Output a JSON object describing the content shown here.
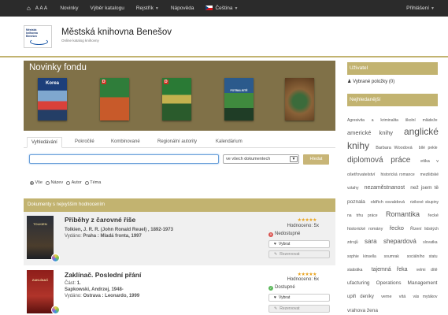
{
  "topbar": {
    "aaa": "A A A",
    "items": [
      "Novinky",
      "Výběr katalogu",
      "Rejstřík",
      "Nápověda",
      "Čeština"
    ],
    "login": "Přihlášení"
  },
  "header": {
    "logo_text": "Městská knihovna Benešov",
    "title": "Městská knihovna Benešov",
    "subtitle": "Online katalog knihovny"
  },
  "novinky": {
    "title": "Novinky fondu",
    "covers": [
      {
        "label": "Korea",
        "color": "#1d3f7a"
      },
      {
        "label": "D",
        "color": "#2f7d3a"
      },
      {
        "label": "D",
        "color": "#2a7a35"
      },
      {
        "label": "FOTBALISTÉ",
        "color": "#2b5a8c"
      },
      {
        "label": "",
        "color": "#8a6238"
      }
    ]
  },
  "search": {
    "tabs": [
      "Vyhledávání",
      "Pokročilé",
      "Kombinované",
      "Regionální autority",
      "Kalendárium"
    ],
    "input_value": "",
    "scope": "ve všech dokumentech",
    "button": "Hledat",
    "radios": [
      "Vše",
      "Název",
      "Autor",
      "Téma"
    ],
    "radio_selected": "Vše"
  },
  "best": {
    "title": "Dokumenty s nejvyšším hodnocením",
    "records": [
      {
        "title": "Příběhy z čarovné říše",
        "author": "Tolkien, J. R. R. (John Ronald Reuel) , 1892-1973",
        "published_label": "Vydáno:",
        "publisher": "Praha : Mladá fronta, 1997",
        "stars": "★★★★★",
        "rating": "Hodnoceno: 5x",
        "status": "Nedostupné",
        "status_color": "#d9534f",
        "btn_select": "Vybrat",
        "btn_reserve": "Rezervovat",
        "cover_color": "#2a2f3a"
      },
      {
        "title": "Zaklínač. Poslední přání",
        "part_label": "Část:",
        "part": "1.",
        "author": "Sapkowski, Andrzej, 1948-",
        "published_label": "Vydáno:",
        "publisher": "Ostrava : Leonardo, 1999",
        "stars": "★★★★★",
        "rating": "Hodnoceno: 6x",
        "status": "Dostupné",
        "status_color": "#5cb85c",
        "btn_select": "Vybrat",
        "btn_reserve": "Rezervovat",
        "cover_color": "#8e1e1a"
      }
    ]
  },
  "sidebar": {
    "user_title": "Uživatel",
    "selected_items": "Vybrané položky (0)",
    "popular_title": "Nejhledanější",
    "tags": [
      {
        "t": "Agresivita a kriminalita školní mládeže",
        "s": 5
      },
      {
        "t": "americké knihy",
        "s": 7.5
      },
      {
        "t": "anglické knihy",
        "s": 12
      },
      {
        "t": "Barbara Woodová",
        "s": 5.5
      },
      {
        "t": "bílé pekle",
        "s": 5
      },
      {
        "t": "diplomová práce",
        "s": 10
      },
      {
        "t": "etika v ošetřovatelství",
        "s": 5.5
      },
      {
        "t": "historická romance",
        "s": 5
      },
      {
        "t": "mezilidské vztahy",
        "s": 5
      },
      {
        "t": "nezaměstnanost",
        "s": 7
      },
      {
        "t": "než jsem tě poznala",
        "s": 6.5
      },
      {
        "t": "oldřich osvaldová",
        "s": 5.5
      },
      {
        "t": "rizikové skupiny na trhu práce",
        "s": 5
      },
      {
        "t": "Romantika",
        "s": 9
      },
      {
        "t": "řecké historické romány",
        "s": 5.5
      },
      {
        "t": "řecko",
        "s": 7.5
      },
      {
        "t": "Řízení lidských zdrojů",
        "s": 5
      },
      {
        "t": "sara",
        "s": 8
      },
      {
        "t": "shepardová",
        "s": 8
      },
      {
        "t": "slovatka",
        "s": 5
      },
      {
        "t": "sophie kinsella",
        "s": 5
      },
      {
        "t": "soumrak",
        "s": 5
      },
      {
        "t": "sociálního statu",
        "s": 5
      },
      {
        "t": "statistika",
        "s": 5
      },
      {
        "t": "tajemná řeka",
        "s": 7
      },
      {
        "t": "velmi dítě",
        "s": 5
      },
      {
        "t": "ufacturing Operations Management",
        "s": 6.5
      },
      {
        "t": "uplň deníky",
        "s": 6
      },
      {
        "t": "veme",
        "s": 5.5
      },
      {
        "t": "vitá",
        "s": 5.5
      },
      {
        "t": "vás mytákov",
        "s": 5
      },
      {
        "t": "vrahova žena",
        "s": 6.5
      }
    ]
  }
}
